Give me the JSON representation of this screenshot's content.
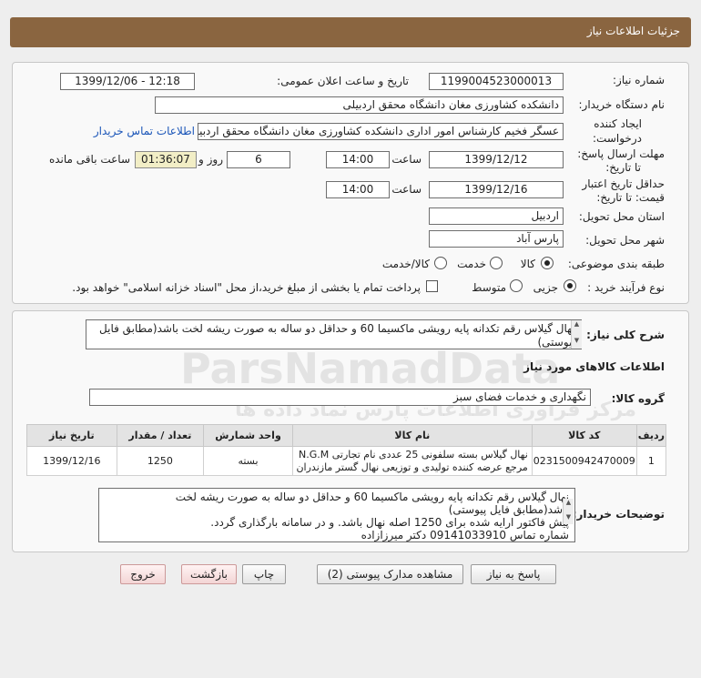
{
  "window": {
    "title": "جزئیات اطلاعات نیاز"
  },
  "header": {
    "need_number_label": "شماره نیاز:",
    "need_number": "1199004523000013",
    "announce_label": "تاریخ و ساعت اعلان عمومی:",
    "announce_value": "1399/12/06 - 12:18",
    "buyer_org_label": "نام دستگاه خریدار:",
    "buyer_org": "دانشکده کشاورزی مغان دانشگاه محقق اردبیلی",
    "creator_label_1": "ایجاد کننده",
    "creator_label_2": "درخواست:",
    "creator": "عسگر فخیم کارشناس امور اداری دانشکده کشاورزی مغان دانشگاه محقق اردبیلی",
    "contact_link": "اطلاعات تماس خریدار",
    "reply_deadline_label_1": "مهلت ارسال پاسخ:",
    "reply_deadline_label_2": "تا تاریخ:",
    "reply_date": "1399/12/12",
    "time_label": "ساعت",
    "reply_time": "14:00",
    "days_value": "6",
    "days_label": "روز و",
    "remaining_value": "01:36:07",
    "remaining_label": "ساعت باقی مانده",
    "validity_label_1": "حداقل تاریخ اعتبار",
    "validity_label_2": "قیمت: تا تاریخ:",
    "validity_date": "1399/12/16",
    "validity_time_label": "ساعت",
    "validity_time": "14:00",
    "province_label": "استان محل تحویل:",
    "province": "اردبیل",
    "city_label": "شهر محل تحویل:",
    "city": "پارس آباد",
    "category_label": "طبقه بندی موضوعی:",
    "category_options": [
      "کالا",
      "خدمت",
      "کالا/خدمت"
    ],
    "category_selected": "کالا",
    "process_label": "نوع فرآیند خرید :",
    "process_options": [
      "جزیی",
      "متوسط"
    ],
    "process_selected": "جزیی",
    "payment_note": "پرداخت تمام یا بخشی از مبلغ خرید،از محل \"اسناد خزانه اسلامی\" خواهد بود."
  },
  "description": {
    "label": "شرح کلی نیاز:",
    "text": "نهال گیلاس رقم تکدانه پایه رویشی ماکسیما 60 و حداقل دو ساله به صورت ریشه لخت باشد(مطابق فایل پیوستی)"
  },
  "goods": {
    "section_title": "اطلاعات کالاهای مورد نیاز",
    "group_label": "گروه کالا:",
    "group_value": "نگهداری و خدمات فضای سبز",
    "columns": [
      "ردیف",
      "کد کالا",
      "نام کالا",
      "واحد شمارش",
      "تعداد / مقدار",
      "تاریخ نیاز"
    ],
    "rows": [
      {
        "index": "1",
        "code": "0231500942470009",
        "name_line1": "نهال گیلاس بسته سلفونی 25 عددی نام تجارتی N.G.M",
        "name_line2": "مرجع عرضه کننده تولیدی و توزیعی نهال گستر مازندران",
        "unit": "بسته",
        "quantity": "1250",
        "date": "1399/12/16"
      }
    ]
  },
  "buyer_notes": {
    "label": "توضیحات خریدار:",
    "lines": [
      "نهال گیلاس رقم تکدانه پایه رویشی ماکسیما 60 و حداقل دو ساله به صورت ریشه لخت",
      "باشد(مطابق فایل پیوستی)",
      "پیش فاکتور ارایه شده برای 1250 اصله نهال باشد. و در سامانه بارگذاری گردد.",
      "شماره تماس 09141033910 دکتر میرزازاده"
    ]
  },
  "buttons": {
    "reply": "پاسخ به نیاز",
    "attachments": "مشاهده مدارک پیوستی (2)",
    "print": "چاپ",
    "back": "بازگشت",
    "exit": "خروج"
  },
  "watermark": {
    "brand": "ParsNamadData",
    "fa": "مرکز فراوری اطلاعات پارس نماد داده ها"
  }
}
